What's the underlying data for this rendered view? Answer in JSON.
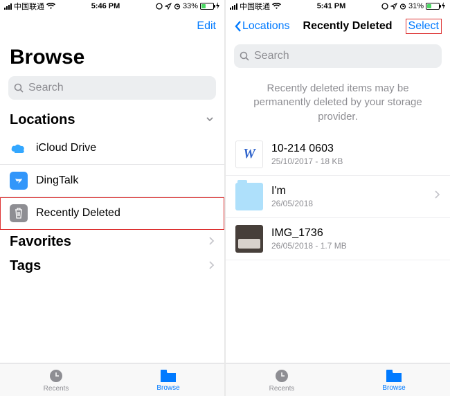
{
  "left": {
    "status": {
      "carrier": "中国联通",
      "time": "5:46 PM",
      "battery_pct": "33%",
      "battery_fill": 33
    },
    "nav": {
      "edit": "Edit"
    },
    "title": "Browse",
    "search": {
      "placeholder": "Search"
    },
    "sections": {
      "locations": {
        "label": "Locations",
        "items": [
          {
            "name": "icloud",
            "label": "iCloud Drive"
          },
          {
            "name": "dingtalk",
            "label": "DingTalk"
          },
          {
            "name": "recently-deleted",
            "label": "Recently Deleted",
            "highlighted": true
          }
        ]
      },
      "favorites": {
        "label": "Favorites"
      },
      "tags": {
        "label": "Tags"
      }
    },
    "tabs": {
      "recents": "Recents",
      "browse": "Browse"
    }
  },
  "right": {
    "status": {
      "carrier": "中国联通",
      "time": "5:41 PM",
      "battery_pct": "31%",
      "battery_fill": 31
    },
    "nav": {
      "back": "Locations",
      "title": "Recently Deleted",
      "select": "Select"
    },
    "search": {
      "placeholder": "Search"
    },
    "info": "Recently deleted items may be permanently deleted by your storage provider.",
    "files": [
      {
        "type": "doc",
        "glyph": "W",
        "name": "10-214  0603",
        "sub": "25/10/2017 - 18 KB"
      },
      {
        "type": "folder",
        "name": "I'm",
        "sub": "26/05/2018",
        "chevron": true
      },
      {
        "type": "image",
        "name": "IMG_1736",
        "sub": "26/05/2018 - 1.7 MB"
      }
    ],
    "tabs": {
      "recents": "Recents",
      "browse": "Browse"
    }
  }
}
